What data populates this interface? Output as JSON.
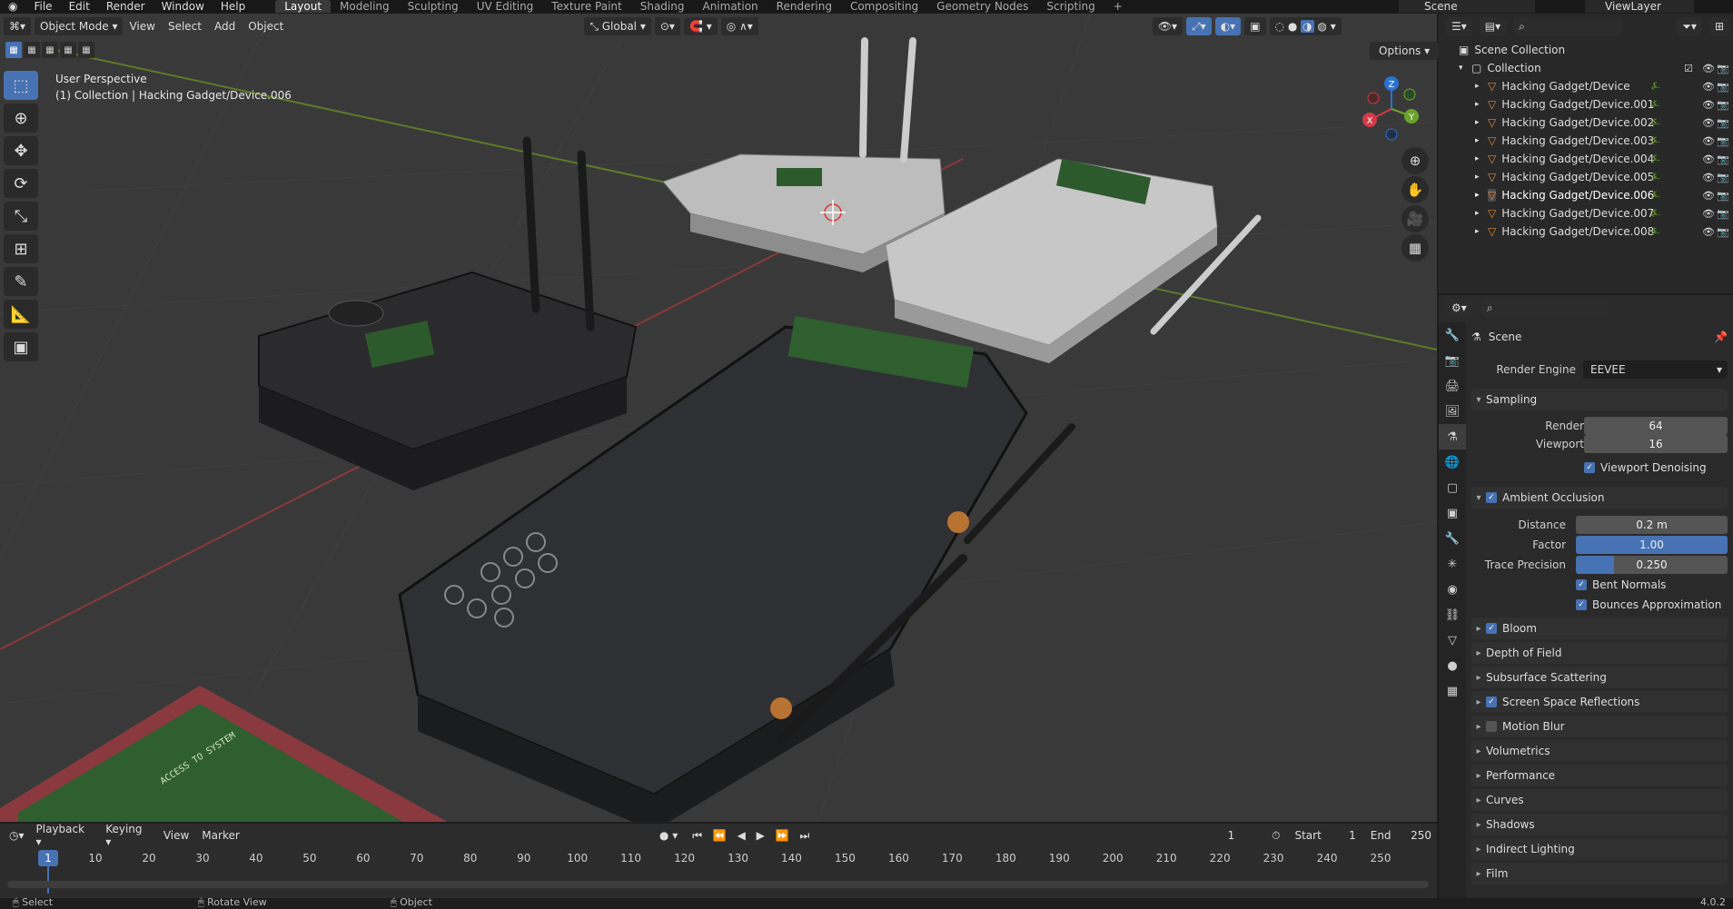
{
  "menubar": {
    "menus": [
      "File",
      "Edit",
      "Render",
      "Window",
      "Help"
    ],
    "workspaces": [
      "Layout",
      "Modeling",
      "Sculpting",
      "UV Editing",
      "Texture Paint",
      "Shading",
      "Animation",
      "Rendering",
      "Compositing",
      "Geometry Nodes",
      "Scripting"
    ],
    "active_workspace": "Layout",
    "add_tab": "+",
    "scene": "Scene",
    "view_layer": "ViewLayer"
  },
  "viewport": {
    "mode": "Object Mode",
    "menus": [
      "View",
      "Select",
      "Add",
      "Object"
    ],
    "transform_orientation": "Global",
    "perspective_label": "User Perspective",
    "context_label": "(1) Collection | Hacking Gadget/Device.006",
    "options": "Options",
    "gizmo_axes": {
      "x": "X",
      "y": "Y",
      "z": "Z"
    },
    "screen_text_1": "ACCESS TO SYSTEM"
  },
  "outliner": {
    "root": "Scene Collection",
    "collection": "Collection",
    "items": [
      "Hacking Gadget/Device",
      "Hacking Gadget/Device.001",
      "Hacking Gadget/Device.002",
      "Hacking Gadget/Device.003",
      "Hacking Gadget/Device.004",
      "Hacking Gadget/Device.005",
      "Hacking Gadget/Device.006",
      "Hacking Gadget/Device.007",
      "Hacking Gadget/Device.008"
    ],
    "active_index": 6
  },
  "properties": {
    "context": "Scene",
    "render_engine_label": "Render Engine",
    "render_engine": "EEVEE",
    "sampling": {
      "title": "Sampling",
      "render_label": "Render",
      "render": "64",
      "viewport_label": "Viewport",
      "viewport": "16",
      "denoise": "Viewport Denoising"
    },
    "ao": {
      "title": "Ambient Occlusion",
      "distance_label": "Distance",
      "distance": "0.2 m",
      "factor_label": "Factor",
      "factor": "1.00",
      "factor_fill": 1.0,
      "trace_label": "Trace Precision",
      "trace": "0.250",
      "trace_fill": 0.25,
      "bent": "Bent Normals",
      "bounces": "Bounces Approximation"
    },
    "sections": [
      {
        "title": "Bloom",
        "checkbox": true,
        "checked": true
      },
      {
        "title": "Depth of Field",
        "checkbox": false
      },
      {
        "title": "Subsurface Scattering",
        "checkbox": false
      },
      {
        "title": "Screen Space Reflections",
        "checkbox": true,
        "checked": true
      },
      {
        "title": "Motion Blur",
        "checkbox": true,
        "checked": false
      },
      {
        "title": "Volumetrics",
        "checkbox": false
      },
      {
        "title": "Performance",
        "checkbox": false
      },
      {
        "title": "Curves",
        "checkbox": false
      },
      {
        "title": "Shadows",
        "checkbox": false
      },
      {
        "title": "Indirect Lighting",
        "checkbox": false
      },
      {
        "title": "Film",
        "checkbox": false
      }
    ]
  },
  "timeline": {
    "menus": [
      "Playback",
      "Keying",
      "View",
      "Marker"
    ],
    "current_frame": "1",
    "start_label": "Start",
    "start": "1",
    "end_label": "End",
    "end": "250",
    "ticks": [
      "10",
      "20",
      "30",
      "40",
      "50",
      "60",
      "70",
      "80",
      "90",
      "100",
      "110",
      "120",
      "130",
      "140",
      "150",
      "160",
      "170",
      "180",
      "190",
      "200",
      "210",
      "220",
      "230",
      "240",
      "250"
    ],
    "playhead": "1"
  },
  "statusbar": {
    "select": "Select",
    "rotate": "Rotate View",
    "object": "Object",
    "version": "4.0.2"
  },
  "colors": {
    "accent": "#4772b3",
    "grid_x": "#8a3a3a",
    "grid_y": "#5f7a2a",
    "active_bg": "#3a3a3a"
  }
}
